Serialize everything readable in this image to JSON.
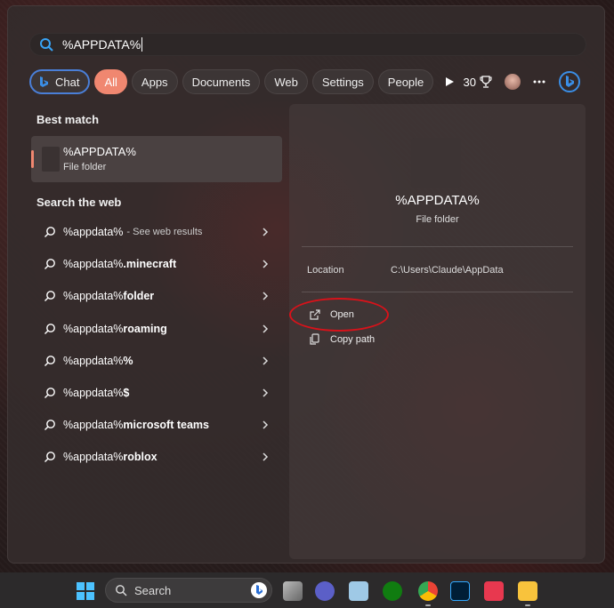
{
  "search": {
    "value": "%APPDATA%"
  },
  "filters": {
    "chat": "Chat",
    "all": "All",
    "apps": "Apps",
    "documents": "Documents",
    "web": "Web",
    "settings": "Settings",
    "people": "People"
  },
  "rewards": {
    "points": "30"
  },
  "best_match": {
    "title": "Best match",
    "name": "%APPDATA%",
    "type": "File folder"
  },
  "web_section": {
    "title": "Search the web",
    "items": [
      {
        "query": "%appdata%",
        "suffix": " - See web results",
        "bold": ""
      },
      {
        "query": "%appdata%",
        "suffix": "",
        "bold": " .minecraft"
      },
      {
        "query": "%appdata%",
        "suffix": "",
        "bold": " folder"
      },
      {
        "query": "%appdata%",
        "suffix": "",
        "bold": " roaming"
      },
      {
        "query": "%appdata%",
        "suffix": "",
        "bold": "%"
      },
      {
        "query": "%appdata%",
        "suffix": "",
        "bold": "$"
      },
      {
        "query": "%appdata%",
        "suffix": "",
        "bold": " microsoft teams"
      },
      {
        "query": "%appdata%",
        "suffix": "",
        "bold": " roblox"
      }
    ]
  },
  "detail": {
    "name": "%APPDATA%",
    "type": "File folder",
    "location_label": "Location",
    "location_value": "C:\\Users\\Claude\\AppData",
    "actions": {
      "open": "Open",
      "copy_path": "Copy path"
    }
  },
  "taskbar": {
    "search_label": "Search"
  },
  "colors": {
    "accent": "#f08770",
    "annotation": "#d8121a",
    "chat_border": "#4a7fd8"
  }
}
